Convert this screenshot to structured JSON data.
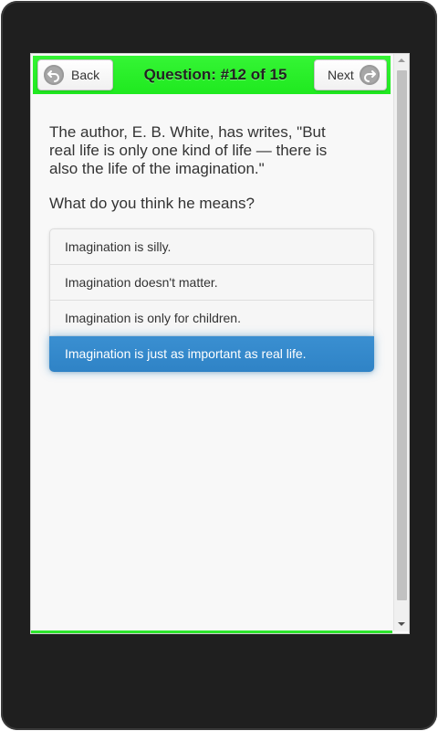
{
  "header": {
    "back_label": "Back",
    "title": "Question: #12 of 15",
    "next_label": "Next",
    "accent_color": "#2cf02c"
  },
  "question": {
    "text": "The author, E. B. White, has writes, \"But real life is only one kind of life — there is also the life of the imagination.\"",
    "prompt": "What do you think he means?"
  },
  "choices": [
    {
      "label": "Imagination is silly.",
      "selected": false
    },
    {
      "label": "Imagination doesn't matter.",
      "selected": false
    },
    {
      "label": "Imagination is only for children.",
      "selected": false
    },
    {
      "label": "Imagination is just as important as real life.",
      "selected": true
    }
  ],
  "colors": {
    "selected_choice": "#3388cc",
    "device_frame": "#1f1f1f"
  },
  "icons": {
    "back": "back-arrow-icon",
    "next": "forward-arrow-icon"
  }
}
